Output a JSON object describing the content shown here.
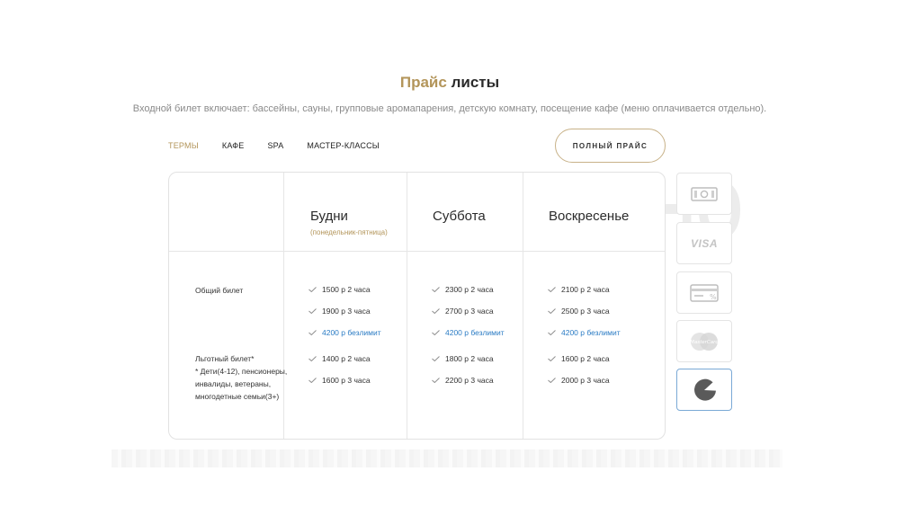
{
  "header": {
    "title_accent": "Прайс",
    "title_rest": "листы",
    "subtitle": "Входной билет включает: бассейны, сауны, групповые аромапарения, детскую комнату, посещение кафе (меню оплачивается отдельно)."
  },
  "tabs": [
    {
      "label": "ТЕРМЫ",
      "active": true
    },
    {
      "label": "КАФЕ",
      "active": false
    },
    {
      "label": "SPA",
      "active": false
    },
    {
      "label": "МАСТЕР-КЛАССЫ",
      "active": false
    }
  ],
  "full_price_button": "ПОЛНЫЙ ПРАЙС",
  "table": {
    "columns": [
      {
        "title": "Будни",
        "subtitle": "(понедельник-пятница)"
      },
      {
        "title": "Суббота",
        "subtitle": ""
      },
      {
        "title": "Воскресенье",
        "subtitle": ""
      }
    ],
    "rows": [
      {
        "label": "Общий билет"
      },
      {
        "label_line1": "Льготный билет*",
        "label_line2": "* Дети(4-12), пенсионеры,",
        "label_line3": "инвалиды, ветераны,",
        "label_line4": "многодетные семьи(3+)"
      }
    ],
    "general": [
      [
        "1500 р 2 часа",
        "1900 р 3 часа",
        "4200 р безлимит"
      ],
      [
        "2300 р 2 часа",
        "2700 р 3 часа",
        "4200 р безлимит"
      ],
      [
        "2100 р 2 часа",
        "2500 р 3 часа",
        "4200 р безлимит"
      ]
    ],
    "discount": [
      [
        "1400 р 2 часа",
        "1600 р 3 часа"
      ],
      [
        "1800 р 2 часа",
        "2200 р 3 часа"
      ],
      [
        "1600 р 2 часа",
        "2000 р 3 часа"
      ]
    ]
  },
  "payment_methods": [
    {
      "icon": "cash-icon",
      "label": ""
    },
    {
      "icon": "visa-icon",
      "label": "VISA"
    },
    {
      "icon": "card-discount-icon",
      "label": ""
    },
    {
      "icon": "mastercard-icon",
      "label": "MasterCard"
    },
    {
      "icon": "pacman-pay-icon",
      "label": "",
      "active": true
    }
  ],
  "colors": {
    "accent_gold": "#b3955a",
    "unlimited_blue": "#2a7bc4"
  }
}
